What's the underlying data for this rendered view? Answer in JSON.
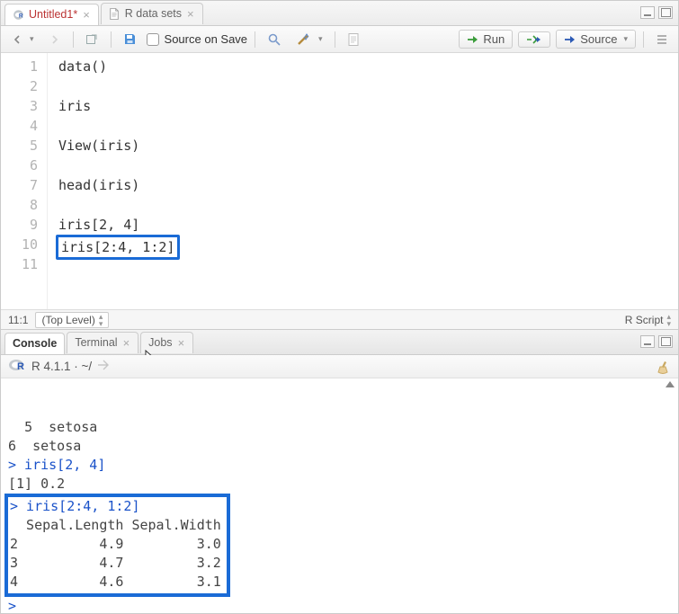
{
  "editor": {
    "tabs": [
      {
        "name": "Untitled1*",
        "dirty": true,
        "active": true
      },
      {
        "name": "R data sets",
        "dirty": false,
        "active": false
      }
    ],
    "toolbar": {
      "source_on_save": "Source on Save",
      "run": "Run",
      "source": "Source"
    },
    "code_lines": [
      "data()",
      "",
      "iris",
      "",
      "View(iris)",
      "",
      "head(iris)",
      "",
      "iris[2, 4]",
      "iris[2:4, 1:2]",
      ""
    ],
    "highlight_line_index": 9,
    "status": {
      "pos": "11:1",
      "scope": "(Top Level)",
      "lang": "R Script"
    }
  },
  "console": {
    "tabs": [
      {
        "name": "Console",
        "active": true
      },
      {
        "name": "Terminal",
        "active": false
      },
      {
        "name": "Jobs",
        "active": false
      }
    ],
    "info": "R 4.1.1 · ~/",
    "output_pre": [
      "5  setosa",
      "6  setosa"
    ],
    "cmd1": "iris[2, 4]",
    "cmd1_out": "[1] 0.2",
    "cmd2": "iris[2:4, 1:2]",
    "cmd2_table": [
      "  Sepal.Length Sepal.Width",
      "2          4.9         3.0",
      "3          4.7         3.2",
      "4          4.6         3.1"
    ],
    "prompt_last": "> "
  }
}
